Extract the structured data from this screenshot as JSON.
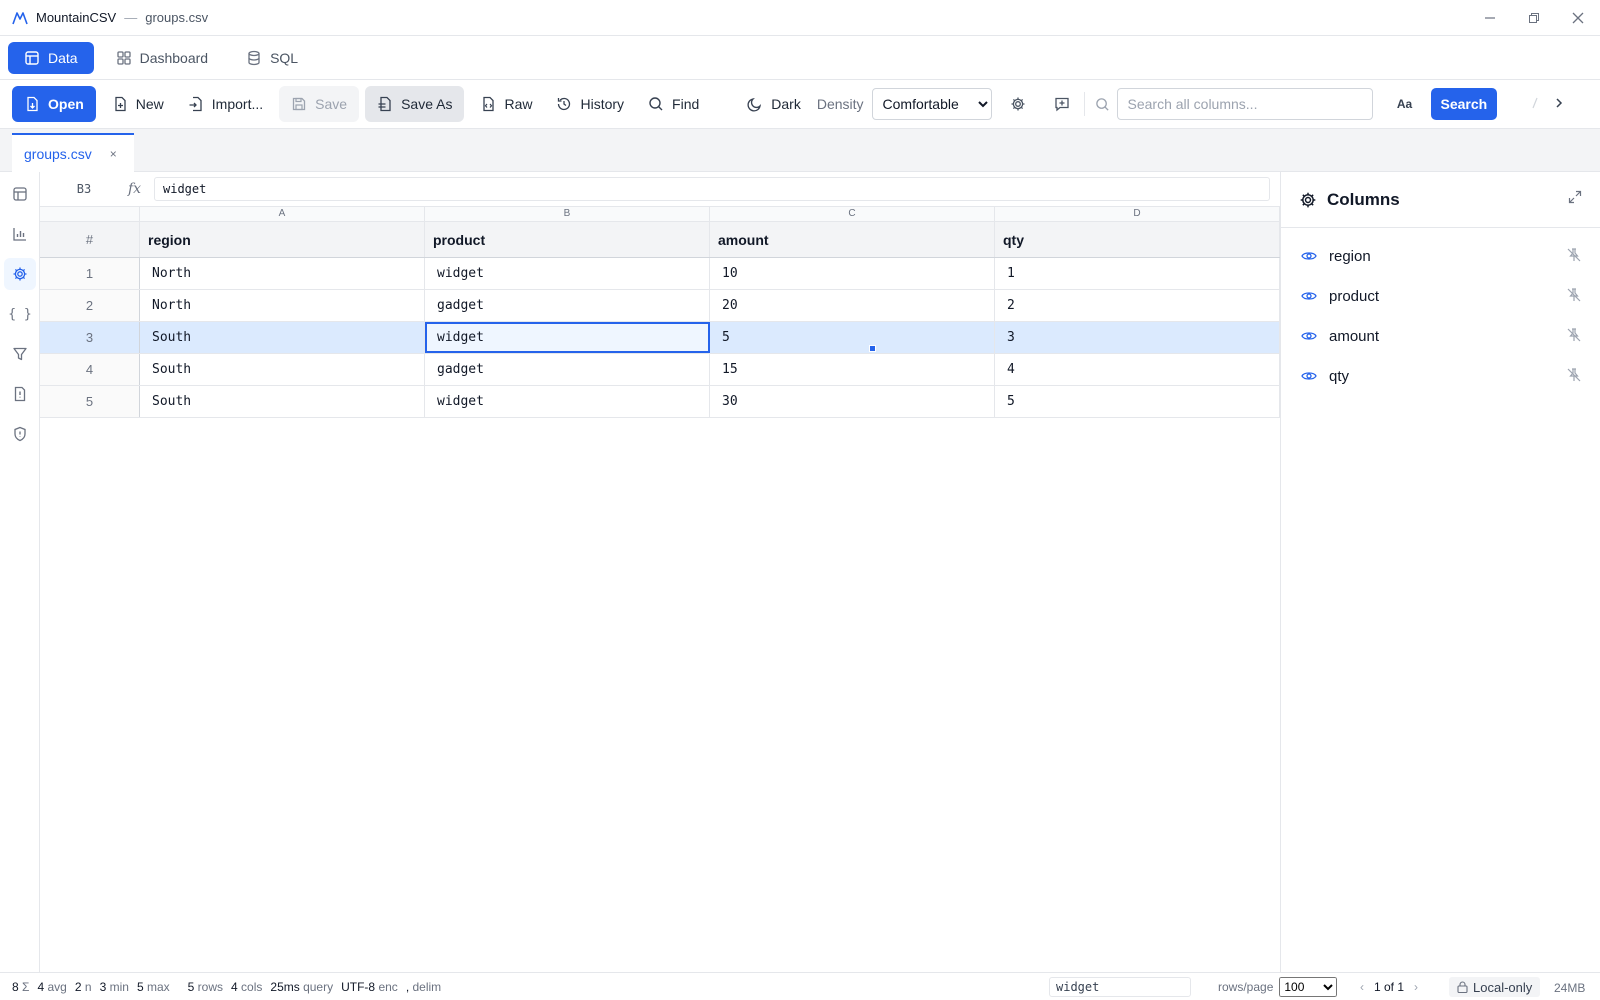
{
  "window": {
    "app_name": "MountainCSV",
    "separator": "—",
    "file_name": "groups.csv"
  },
  "nav": {
    "tabs": [
      {
        "label": "Data"
      },
      {
        "label": "Dashboard"
      },
      {
        "label": "SQL"
      }
    ]
  },
  "toolbar": {
    "open": "Open",
    "new": "New",
    "import": "Import...",
    "save": "Save",
    "save_as": "Save As",
    "raw": "Raw",
    "history": "History",
    "find": "Find",
    "dark": "Dark",
    "density_label": "Density",
    "density_value": "Comfortable",
    "search_placeholder": "Search all columns...",
    "case_toggle": "Aa",
    "search_button": "Search"
  },
  "doc_tab": {
    "name": "groups.csv",
    "close": "×"
  },
  "formula_bar": {
    "cell_ref": "B3",
    "fx": "fx",
    "value": "widget"
  },
  "grid": {
    "column_letters": [
      "A",
      "B",
      "C",
      "D"
    ],
    "rownum_header": "#",
    "headers": [
      "region",
      "product",
      "amount",
      "qty"
    ],
    "rows": [
      {
        "n": "1",
        "cells": [
          "North",
          "widget",
          "10",
          "1"
        ]
      },
      {
        "n": "2",
        "cells": [
          "North",
          "gadget",
          "20",
          "2"
        ]
      },
      {
        "n": "3",
        "cells": [
          "South",
          "widget",
          "5",
          "3"
        ]
      },
      {
        "n": "4",
        "cells": [
          "South",
          "gadget",
          "15",
          "4"
        ]
      },
      {
        "n": "5",
        "cells": [
          "South",
          "widget",
          "30",
          "5"
        ]
      }
    ],
    "selected_row": 3,
    "active_cell": "B3"
  },
  "panel": {
    "title": "Columns",
    "columns": [
      "region",
      "product",
      "amount",
      "qty"
    ]
  },
  "status": {
    "sum_val": "8",
    "sum_lbl": "Σ",
    "avg_val": "4",
    "avg_lbl": "avg",
    "n_val": "2",
    "n_lbl": "n",
    "min_val": "3",
    "min_lbl": "min",
    "max_val": "5",
    "max_lbl": "max",
    "rows_val": "5",
    "rows_lbl": "rows",
    "cols_val": "4",
    "cols_lbl": "cols",
    "query_val": "25ms",
    "query_lbl": "query",
    "enc_val": "UTF-8",
    "enc_lbl": "enc",
    "delim_val": ",",
    "delim_lbl": "delim",
    "cell_value": "widget",
    "rows_per_page_label": "rows/page",
    "rows_per_page": "100",
    "page_info": "1 of 1",
    "local_label": "Local-only",
    "memory": "24MB"
  },
  "colors": {
    "accent": "#2563eb",
    "selection": "#dbeafe"
  }
}
